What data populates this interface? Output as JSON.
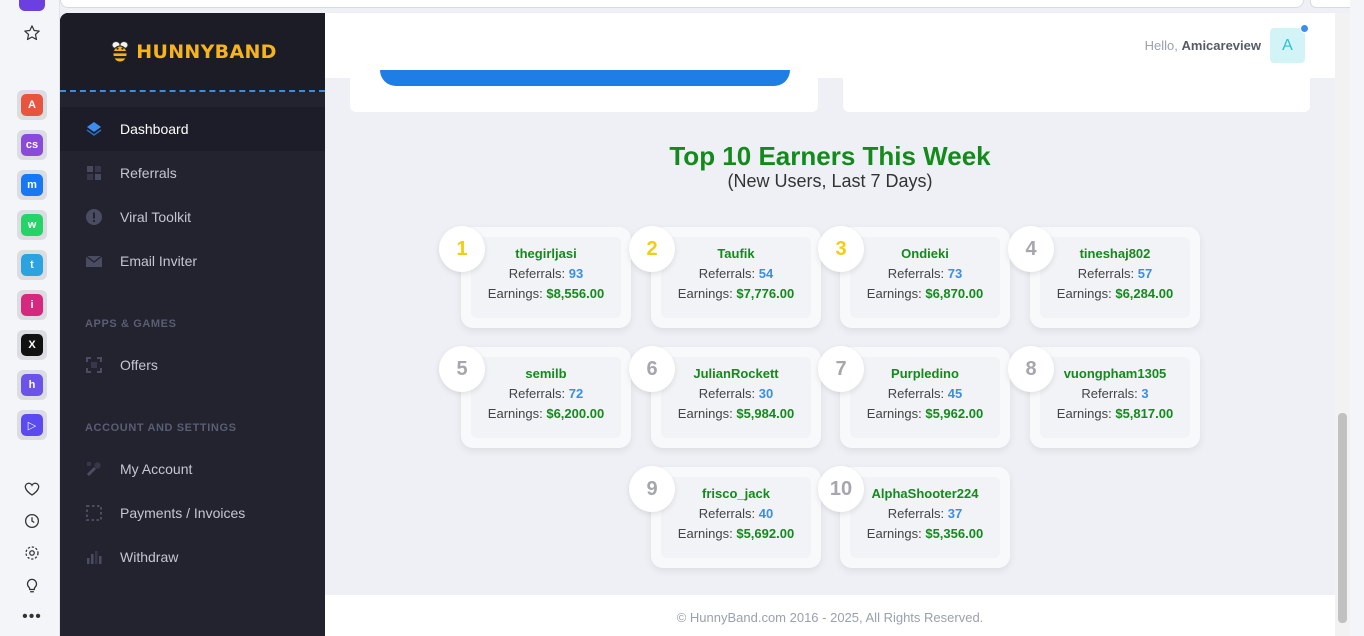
{
  "browser": {
    "apps": [
      {
        "name": "anyword",
        "color": "#e8553f",
        "glyph": "A"
      },
      {
        "name": "cs",
        "color": "#8a4bd8",
        "glyph": "cs"
      },
      {
        "name": "messenger",
        "color": "#1877f2",
        "glyph": "m"
      },
      {
        "name": "whatsapp",
        "color": "#25d366",
        "glyph": "w"
      },
      {
        "name": "telegram",
        "color": "#2aa3e0",
        "glyph": "t"
      },
      {
        "name": "instagram",
        "color": "#d6287f",
        "glyph": "i"
      },
      {
        "name": "x",
        "color": "#111111",
        "glyph": "X"
      },
      {
        "name": "headphones",
        "color": "#6b52e8",
        "glyph": "h"
      },
      {
        "name": "player",
        "color": "#5a4af0",
        "glyph": "▷"
      }
    ]
  },
  "brand": {
    "name": "HunnyBand",
    "accent": "#f6b41a"
  },
  "nav": {
    "dashboard": "Dashboard",
    "referrals": "Referrals",
    "viral_toolkit": "Viral Toolkit",
    "email_inviter": "Email Inviter",
    "section_apps": "APPS & GAMES",
    "offers": "Offers",
    "section_account": "ACCOUNT AND SETTINGS",
    "my_account": "My Account",
    "payments": "Payments / Invoices",
    "withdraw": "Withdraw"
  },
  "header": {
    "greeting": "Hello,",
    "username": "Amicareview",
    "avatar_letter": "A"
  },
  "leaderboard": {
    "title": "Top 10 Earners This Week",
    "subtitle": "(New Users, Last 7 Days)",
    "referrals_label": "Referrals:",
    "earnings_label": "Earnings:",
    "earners": [
      {
        "rank": "1",
        "name": "thegirljasi",
        "referrals": "93",
        "earnings": "$8,556.00"
      },
      {
        "rank": "2",
        "name": "Taufik",
        "referrals": "54",
        "earnings": "$7,776.00"
      },
      {
        "rank": "3",
        "name": "Ondieki",
        "referrals": "73",
        "earnings": "$6,870.00"
      },
      {
        "rank": "4",
        "name": "tineshaj802",
        "referrals": "57",
        "earnings": "$6,284.00"
      },
      {
        "rank": "5",
        "name": "semilb",
        "referrals": "72",
        "earnings": "$6,200.00"
      },
      {
        "rank": "6",
        "name": "JulianRockett",
        "referrals": "30",
        "earnings": "$5,984.00"
      },
      {
        "rank": "7",
        "name": "Purpledino",
        "referrals": "45",
        "earnings": "$5,962.00"
      },
      {
        "rank": "8",
        "name": "vuongpham1305",
        "referrals": "3",
        "earnings": "$5,817.00"
      },
      {
        "rank": "9",
        "name": "frisco_jack",
        "referrals": "40",
        "earnings": "$5,692.00"
      },
      {
        "rank": "10",
        "name": "AlphaShooter224",
        "referrals": "37",
        "earnings": "$5,356.00"
      }
    ]
  },
  "footer": {
    "text": "© HunnyBand.com 2016 - 2025, All Rights Reserved."
  }
}
